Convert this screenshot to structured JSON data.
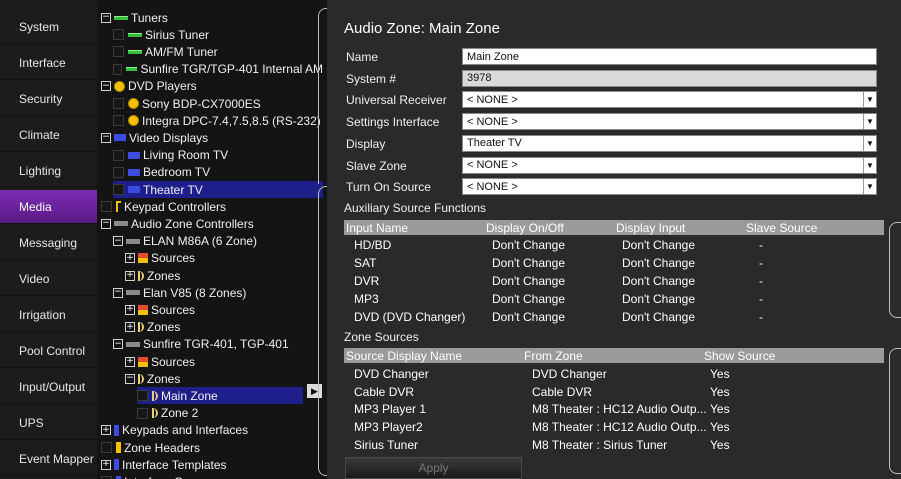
{
  "sidebar": {
    "items": [
      "System",
      "Interface",
      "Security",
      "Climate",
      "Lighting",
      "Media",
      "Messaging",
      "Video",
      "Irrigation",
      "Pool Control",
      "Input/Output",
      "UPS",
      "Event Mapper"
    ],
    "active": "Media"
  },
  "tree": {
    "rows": [
      {
        "label": "Tuners",
        "toggle": "−",
        "icon": "green"
      },
      {
        "label": "Sirius Tuner",
        "icon": "green"
      },
      {
        "label": "AM/FM Tuner",
        "icon": "green"
      },
      {
        "label": "Sunfire TGR/TGP-401 Internal AM",
        "icon": "green"
      },
      {
        "label": "DVD Players",
        "toggle": "−",
        "icon": "yellow"
      },
      {
        "label": "Sony BDP-CX7000ES",
        "icon": "yellow"
      },
      {
        "label": "Integra DPC-7.4,7.5,8.5 (RS-232)",
        "icon": "yellow"
      },
      {
        "label": "Video Displays",
        "toggle": "−",
        "icon": "blue"
      },
      {
        "label": "Living Room TV",
        "icon": "blue"
      },
      {
        "label": "Bedroom TV",
        "icon": "blue"
      },
      {
        "label": "Theater TV",
        "icon": "blue",
        "selected": true
      },
      {
        "label": "Keypad Controllers",
        "icon": "note"
      },
      {
        "label": "Audio Zone Controllers",
        "toggle": "−",
        "icon": "gray"
      },
      {
        "label": "ELAN M86A (6 Zone)",
        "toggle": "−",
        "icon": "gray"
      },
      {
        "label": "Sources",
        "toggle": "+",
        "icon": "src"
      },
      {
        "label": "Zones",
        "toggle": "+",
        "icon": "spk"
      },
      {
        "label": "Elan V85 (8 Zones)",
        "toggle": "−",
        "icon": "gray"
      },
      {
        "label": "Sources",
        "toggle": "+",
        "icon": "src"
      },
      {
        "label": "Zones",
        "toggle": "+",
        "icon": "spk"
      },
      {
        "label": "Sunfire TGR-401, TGP-401",
        "toggle": "−",
        "icon": "gray"
      },
      {
        "label": "Sources",
        "toggle": "+",
        "icon": "src"
      },
      {
        "label": "Zones",
        "toggle": "−",
        "icon": "spk"
      },
      {
        "label": "Main Zone",
        "icon": "spk",
        "selected": true
      },
      {
        "label": "Zone 2",
        "icon": "spk"
      },
      {
        "label": "Keypads and Interfaces",
        "toggle": "+",
        "icon": "kp"
      },
      {
        "label": "Zone Headers",
        "icon": "zh"
      },
      {
        "label": "Interface Templates",
        "toggle": "+",
        "icon": "kp"
      },
      {
        "label": "Interface Groups",
        "icon": "kp"
      }
    ],
    "expand_arrow": "▶"
  },
  "main": {
    "title": "Audio Zone: Main Zone",
    "fields": [
      {
        "label": "Name",
        "value": "Main Zone",
        "type": "text"
      },
      {
        "label": "System #",
        "value": "3978",
        "type": "readonly"
      },
      {
        "label": "Universal Receiver",
        "value": "< NONE >",
        "type": "select"
      },
      {
        "label": "Settings Interface",
        "value": "< NONE >",
        "type": "select"
      },
      {
        "label": "Display",
        "value": "Theater TV",
        "type": "select"
      },
      {
        "label": "Slave Zone",
        "value": "< NONE >",
        "type": "select"
      },
      {
        "label": "Turn On Source",
        "value": "< NONE >",
        "type": "select"
      }
    ],
    "select_arrow": "▼",
    "aux": {
      "title": "Auxiliary Source Functions",
      "headers": [
        "Input Name",
        "Display On/Off",
        "Display Input",
        "Slave Source"
      ],
      "rows": [
        [
          "HD/BD",
          "Don't Change",
          "Don't Change",
          "-"
        ],
        [
          "SAT",
          "Don't Change",
          "Don't Change",
          "-"
        ],
        [
          "DVR",
          "Don't Change",
          "Don't Change",
          "-"
        ],
        [
          "MP3",
          "Don't Change",
          "Don't Change",
          "-"
        ],
        [
          "DVD (DVD Changer)",
          "Don't Change",
          "Don't Change",
          "-"
        ]
      ]
    },
    "zone_sources": {
      "title": "Zone Sources",
      "headers": [
        "Source Display Name",
        "From Zone",
        "Show Source"
      ],
      "rows": [
        [
          "DVD Changer",
          "DVD Changer",
          "Yes"
        ],
        [
          "Cable DVR",
          "Cable DVR",
          "Yes"
        ],
        [
          "MP3 Player 1",
          "M8 Theater : HC12 Audio Outp...",
          "Yes"
        ],
        [
          "MP3 Player2",
          "M8 Theater : HC12 Audio Outp...",
          "Yes"
        ],
        [
          "Sirius Tuner",
          "M8 Theater : Sirius Tuner",
          "Yes"
        ]
      ]
    },
    "apply_label": "Apply"
  }
}
